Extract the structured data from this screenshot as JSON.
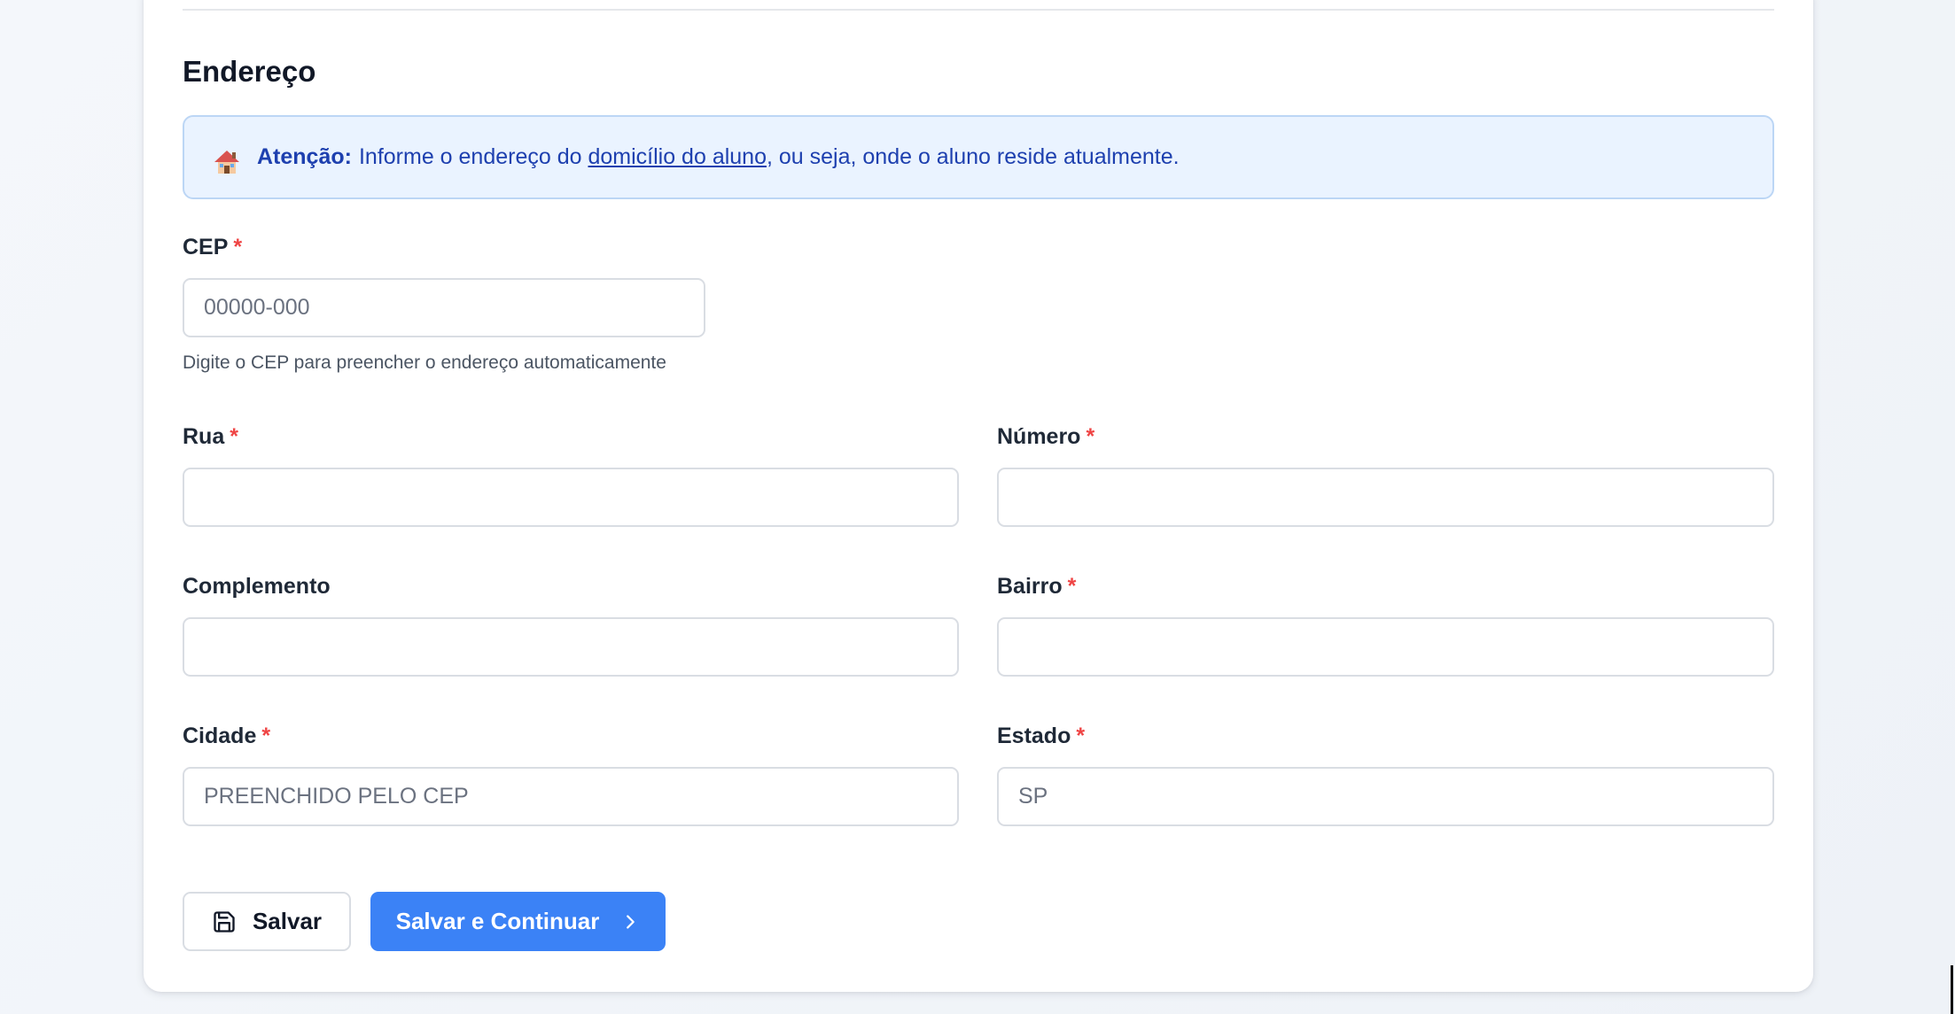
{
  "section": {
    "title": "Endereço"
  },
  "alert": {
    "icon": "house-icon",
    "strong": "Atenção:",
    "text_before": "Informe o endereço do ",
    "link": "domicílio do aluno",
    "text_after": ", ou seja, onde o aluno reside atualmente."
  },
  "required_marker": "*",
  "fields": {
    "cep": {
      "label": "CEP",
      "placeholder": "00000-000",
      "value": "",
      "hint": "Digite o CEP para preencher o endereço automaticamente"
    },
    "rua": {
      "label": "Rua",
      "value": ""
    },
    "numero": {
      "label": "Número",
      "value": ""
    },
    "complemento": {
      "label": "Complemento",
      "value": ""
    },
    "bairro": {
      "label": "Bairro",
      "value": ""
    },
    "cidade": {
      "label": "Cidade",
      "placeholder": "PREENCHIDO PELO CEP",
      "value": ""
    },
    "estado": {
      "label": "Estado",
      "placeholder": "SP",
      "value": ""
    }
  },
  "buttons": {
    "save": {
      "label": "Salvar",
      "icon": "floppy-disk-icon"
    },
    "continue": {
      "label": "Salvar e Continuar",
      "icon": "chevron-right-icon"
    }
  },
  "colors": {
    "primary": "#3b82f6",
    "required": "#ef4444",
    "alert_bg": "#eaf3ff",
    "alert_text": "#1e40af"
  }
}
